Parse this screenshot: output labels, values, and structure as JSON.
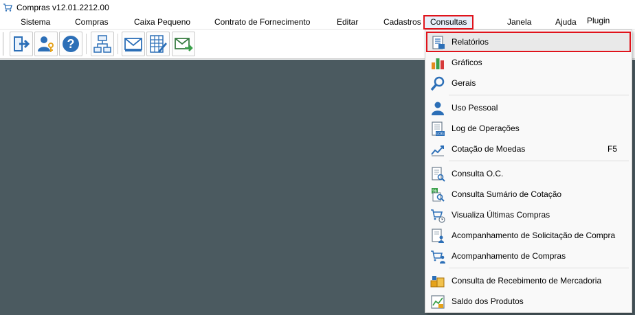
{
  "window": {
    "title": "Compras v12.01.2212.00",
    "app_icon": "cart-icon"
  },
  "menubar": {
    "items": [
      {
        "label": "Sistema"
      },
      {
        "label": "Compras"
      },
      {
        "label": "Caixa Pequeno"
      },
      {
        "label": "Contrato de Fornecimento"
      },
      {
        "label": "Editar"
      },
      {
        "label": "Cadastros"
      },
      {
        "label": "Consultas",
        "open": true
      },
      {
        "label": "Janela"
      },
      {
        "label": "Ajuda"
      },
      {
        "label": "Plugin"
      }
    ]
  },
  "toolbar": {
    "buttons": [
      {
        "icon": "exit-door-icon"
      },
      {
        "icon": "user-key-icon"
      },
      {
        "icon": "help-icon"
      },
      {
        "icon": "org-chart-icon"
      },
      {
        "icon": "mail-open-icon"
      },
      {
        "icon": "spreadsheet-edit-icon"
      },
      {
        "icon": "mail-send-icon"
      }
    ]
  },
  "consultas_menu": {
    "items": [
      {
        "label": "Relatórios",
        "icon": "report-icon",
        "highlighted": true
      },
      {
        "label": "Gráficos",
        "icon": "bar-chart-icon"
      },
      {
        "label": "Gerais",
        "icon": "magnifier-icon"
      },
      {
        "label": "Uso Pessoal",
        "icon": "person-icon"
      },
      {
        "label": "Log de Operações",
        "icon": "log-document-icon"
      },
      {
        "label": "Cotação de Moedas",
        "icon": "currency-chart-icon",
        "shortcut": "F5"
      },
      {
        "label": "Consulta O.C.",
        "icon": "document-search-icon"
      },
      {
        "label": "Consulta Sumário de Cotação",
        "icon": "percent-search-icon"
      },
      {
        "label": "Visualiza Últimas Compras",
        "icon": "cart-clock-icon"
      },
      {
        "label": "Acompanhamento de Solicitação de Compra",
        "icon": "document-person-icon"
      },
      {
        "label": "Acompanhamento de Compras",
        "icon": "cart-person-icon"
      },
      {
        "label": "Consulta de Recebimento de Mercadoria",
        "icon": "boxes-icon"
      },
      {
        "label": "Saldo dos Produtos",
        "icon": "stock-balance-icon"
      }
    ]
  },
  "colors": {
    "workspace": "#4b5a60",
    "highlight_outline": "#e0131b",
    "icon_blue": "#2c6fb7"
  }
}
